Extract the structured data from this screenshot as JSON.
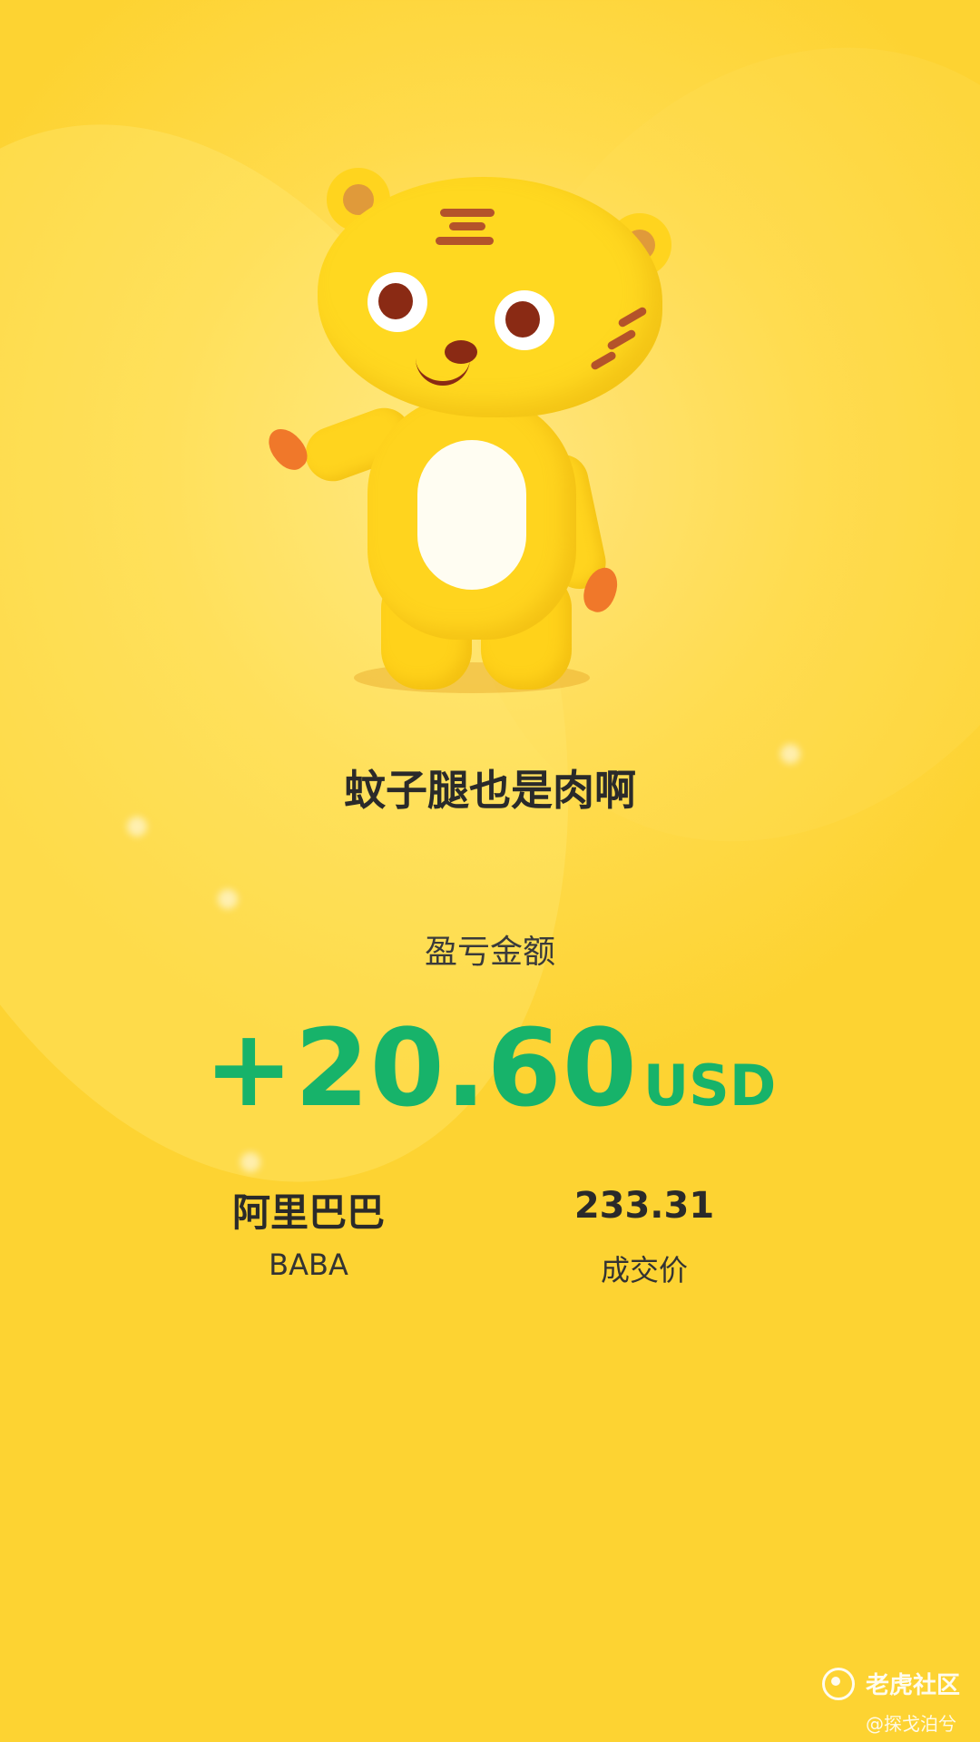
{
  "nickname": "蚊子腿也是肉啊",
  "profit_loss": {
    "label": "盈亏金额",
    "amount": "+20.60",
    "currency": "USD",
    "color": "#17B36A"
  },
  "stock": {
    "name": "阿里巴巴",
    "ticker": "BABA",
    "price": "233.31",
    "price_label": "成交价"
  },
  "watermark": {
    "brand": "老虎社区",
    "user": "@探戈泊兮",
    "icon": "tiger-community-logo-icon"
  },
  "mascot": {
    "icon": "tiger-mascot-illustration"
  }
}
